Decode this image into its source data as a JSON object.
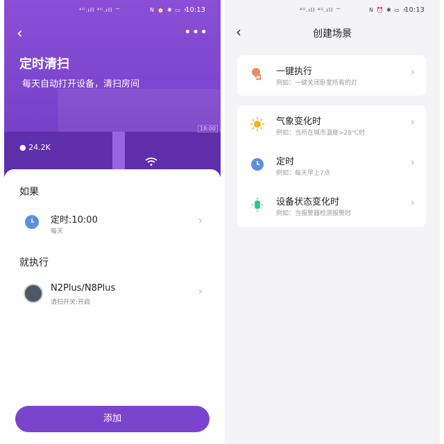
{
  "left": {
    "status": {
      "signal": "⁴ᴳ.ıll ⁴ᴳ.ıll ⌔",
      "icons": "N ⏰ ✱ ▭ ⚡",
      "time": "10:13"
    },
    "header": {
      "title": "定时清扫",
      "subtitle": "每天自动打开设备，清扫房间",
      "likes": "24.2K",
      "mini_time": "18:00"
    },
    "if_section": {
      "label": "如果",
      "item": {
        "title": "定时:10:00",
        "sub": "每天"
      }
    },
    "then_section": {
      "label": "就执行",
      "item": {
        "title": "N2Plus/N8Plus",
        "sub": "清扫开关:开启"
      }
    },
    "add_label": "添加",
    "accent": "#7b44cc"
  },
  "right": {
    "status": {
      "signal": "⁴ᴳ.ıll ⁴ᴳ.ıll ⌔",
      "icons": "N ⏰ ✱ ▭ ⚡",
      "time": "10:13"
    },
    "title": "创建场景",
    "card1": [
      {
        "icon": "tap-hand-icon",
        "title": "一键执行",
        "sub": "例如：一键关闭卧室所有的灯"
      }
    ],
    "card2": [
      {
        "icon": "sun-icon",
        "title": "气象变化时",
        "sub": "例如：当所在城市温度>28℃时"
      },
      {
        "icon": "clock-icon",
        "title": "定时",
        "sub": "例如：每天早上7点"
      },
      {
        "icon": "device-icon",
        "title": "设备状态变化时",
        "sub": "例如：当报警器检测报警时"
      }
    ]
  }
}
